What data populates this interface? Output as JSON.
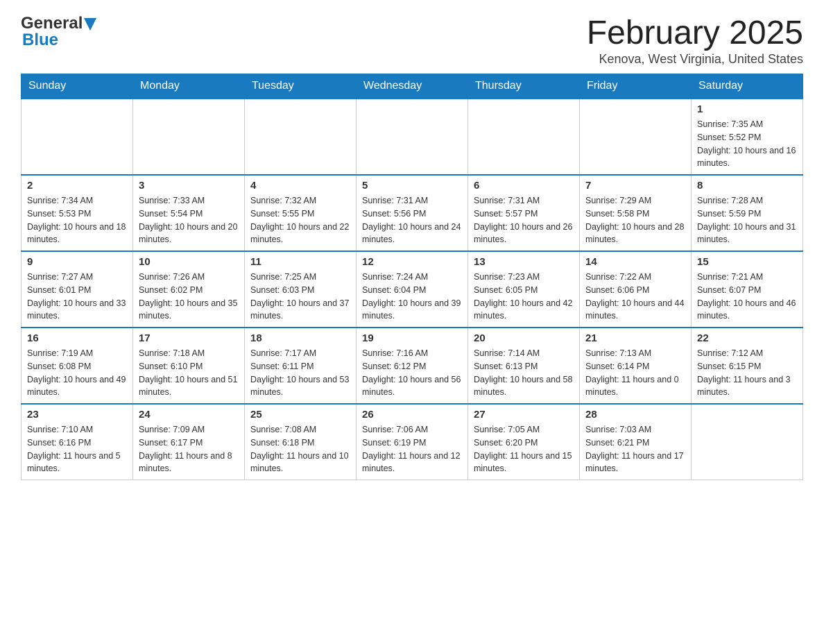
{
  "header": {
    "logo_general": "General",
    "logo_blue": "Blue",
    "title": "February 2025",
    "location": "Kenova, West Virginia, United States"
  },
  "days_of_week": [
    "Sunday",
    "Monday",
    "Tuesday",
    "Wednesday",
    "Thursday",
    "Friday",
    "Saturday"
  ],
  "weeks": [
    {
      "days": [
        {
          "num": "",
          "info": ""
        },
        {
          "num": "",
          "info": ""
        },
        {
          "num": "",
          "info": ""
        },
        {
          "num": "",
          "info": ""
        },
        {
          "num": "",
          "info": ""
        },
        {
          "num": "",
          "info": ""
        },
        {
          "num": "1",
          "info": "Sunrise: 7:35 AM\nSunset: 5:52 PM\nDaylight: 10 hours and 16 minutes."
        }
      ]
    },
    {
      "days": [
        {
          "num": "2",
          "info": "Sunrise: 7:34 AM\nSunset: 5:53 PM\nDaylight: 10 hours and 18 minutes."
        },
        {
          "num": "3",
          "info": "Sunrise: 7:33 AM\nSunset: 5:54 PM\nDaylight: 10 hours and 20 minutes."
        },
        {
          "num": "4",
          "info": "Sunrise: 7:32 AM\nSunset: 5:55 PM\nDaylight: 10 hours and 22 minutes."
        },
        {
          "num": "5",
          "info": "Sunrise: 7:31 AM\nSunset: 5:56 PM\nDaylight: 10 hours and 24 minutes."
        },
        {
          "num": "6",
          "info": "Sunrise: 7:31 AM\nSunset: 5:57 PM\nDaylight: 10 hours and 26 minutes."
        },
        {
          "num": "7",
          "info": "Sunrise: 7:29 AM\nSunset: 5:58 PM\nDaylight: 10 hours and 28 minutes."
        },
        {
          "num": "8",
          "info": "Sunrise: 7:28 AM\nSunset: 5:59 PM\nDaylight: 10 hours and 31 minutes."
        }
      ]
    },
    {
      "days": [
        {
          "num": "9",
          "info": "Sunrise: 7:27 AM\nSunset: 6:01 PM\nDaylight: 10 hours and 33 minutes."
        },
        {
          "num": "10",
          "info": "Sunrise: 7:26 AM\nSunset: 6:02 PM\nDaylight: 10 hours and 35 minutes."
        },
        {
          "num": "11",
          "info": "Sunrise: 7:25 AM\nSunset: 6:03 PM\nDaylight: 10 hours and 37 minutes."
        },
        {
          "num": "12",
          "info": "Sunrise: 7:24 AM\nSunset: 6:04 PM\nDaylight: 10 hours and 39 minutes."
        },
        {
          "num": "13",
          "info": "Sunrise: 7:23 AM\nSunset: 6:05 PM\nDaylight: 10 hours and 42 minutes."
        },
        {
          "num": "14",
          "info": "Sunrise: 7:22 AM\nSunset: 6:06 PM\nDaylight: 10 hours and 44 minutes."
        },
        {
          "num": "15",
          "info": "Sunrise: 7:21 AM\nSunset: 6:07 PM\nDaylight: 10 hours and 46 minutes."
        }
      ]
    },
    {
      "days": [
        {
          "num": "16",
          "info": "Sunrise: 7:19 AM\nSunset: 6:08 PM\nDaylight: 10 hours and 49 minutes."
        },
        {
          "num": "17",
          "info": "Sunrise: 7:18 AM\nSunset: 6:10 PM\nDaylight: 10 hours and 51 minutes."
        },
        {
          "num": "18",
          "info": "Sunrise: 7:17 AM\nSunset: 6:11 PM\nDaylight: 10 hours and 53 minutes."
        },
        {
          "num": "19",
          "info": "Sunrise: 7:16 AM\nSunset: 6:12 PM\nDaylight: 10 hours and 56 minutes."
        },
        {
          "num": "20",
          "info": "Sunrise: 7:14 AM\nSunset: 6:13 PM\nDaylight: 10 hours and 58 minutes."
        },
        {
          "num": "21",
          "info": "Sunrise: 7:13 AM\nSunset: 6:14 PM\nDaylight: 11 hours and 0 minutes."
        },
        {
          "num": "22",
          "info": "Sunrise: 7:12 AM\nSunset: 6:15 PM\nDaylight: 11 hours and 3 minutes."
        }
      ]
    },
    {
      "days": [
        {
          "num": "23",
          "info": "Sunrise: 7:10 AM\nSunset: 6:16 PM\nDaylight: 11 hours and 5 minutes."
        },
        {
          "num": "24",
          "info": "Sunrise: 7:09 AM\nSunset: 6:17 PM\nDaylight: 11 hours and 8 minutes."
        },
        {
          "num": "25",
          "info": "Sunrise: 7:08 AM\nSunset: 6:18 PM\nDaylight: 11 hours and 10 minutes."
        },
        {
          "num": "26",
          "info": "Sunrise: 7:06 AM\nSunset: 6:19 PM\nDaylight: 11 hours and 12 minutes."
        },
        {
          "num": "27",
          "info": "Sunrise: 7:05 AM\nSunset: 6:20 PM\nDaylight: 11 hours and 15 minutes."
        },
        {
          "num": "28",
          "info": "Sunrise: 7:03 AM\nSunset: 6:21 PM\nDaylight: 11 hours and 17 minutes."
        },
        {
          "num": "",
          "info": ""
        }
      ]
    }
  ]
}
